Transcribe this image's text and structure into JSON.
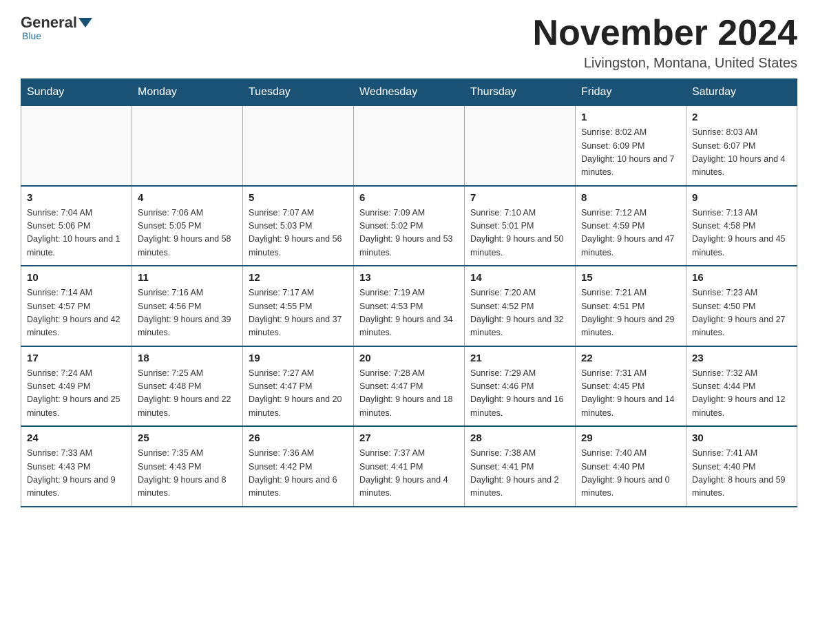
{
  "header": {
    "logo_general": "General",
    "logo_blue": "Blue",
    "month_title": "November 2024",
    "location": "Livingston, Montana, United States"
  },
  "weekdays": [
    "Sunday",
    "Monday",
    "Tuesday",
    "Wednesday",
    "Thursday",
    "Friday",
    "Saturday"
  ],
  "weeks": [
    [
      {
        "day": "",
        "sunrise": "",
        "sunset": "",
        "daylight": ""
      },
      {
        "day": "",
        "sunrise": "",
        "sunset": "",
        "daylight": ""
      },
      {
        "day": "",
        "sunrise": "",
        "sunset": "",
        "daylight": ""
      },
      {
        "day": "",
        "sunrise": "",
        "sunset": "",
        "daylight": ""
      },
      {
        "day": "",
        "sunrise": "",
        "sunset": "",
        "daylight": ""
      },
      {
        "day": "1",
        "sunrise": "Sunrise: 8:02 AM",
        "sunset": "Sunset: 6:09 PM",
        "daylight": "Daylight: 10 hours and 7 minutes."
      },
      {
        "day": "2",
        "sunrise": "Sunrise: 8:03 AM",
        "sunset": "Sunset: 6:07 PM",
        "daylight": "Daylight: 10 hours and 4 minutes."
      }
    ],
    [
      {
        "day": "3",
        "sunrise": "Sunrise: 7:04 AM",
        "sunset": "Sunset: 5:06 PM",
        "daylight": "Daylight: 10 hours and 1 minute."
      },
      {
        "day": "4",
        "sunrise": "Sunrise: 7:06 AM",
        "sunset": "Sunset: 5:05 PM",
        "daylight": "Daylight: 9 hours and 58 minutes."
      },
      {
        "day": "5",
        "sunrise": "Sunrise: 7:07 AM",
        "sunset": "Sunset: 5:03 PM",
        "daylight": "Daylight: 9 hours and 56 minutes."
      },
      {
        "day": "6",
        "sunrise": "Sunrise: 7:09 AM",
        "sunset": "Sunset: 5:02 PM",
        "daylight": "Daylight: 9 hours and 53 minutes."
      },
      {
        "day": "7",
        "sunrise": "Sunrise: 7:10 AM",
        "sunset": "Sunset: 5:01 PM",
        "daylight": "Daylight: 9 hours and 50 minutes."
      },
      {
        "day": "8",
        "sunrise": "Sunrise: 7:12 AM",
        "sunset": "Sunset: 4:59 PM",
        "daylight": "Daylight: 9 hours and 47 minutes."
      },
      {
        "day": "9",
        "sunrise": "Sunrise: 7:13 AM",
        "sunset": "Sunset: 4:58 PM",
        "daylight": "Daylight: 9 hours and 45 minutes."
      }
    ],
    [
      {
        "day": "10",
        "sunrise": "Sunrise: 7:14 AM",
        "sunset": "Sunset: 4:57 PM",
        "daylight": "Daylight: 9 hours and 42 minutes."
      },
      {
        "day": "11",
        "sunrise": "Sunrise: 7:16 AM",
        "sunset": "Sunset: 4:56 PM",
        "daylight": "Daylight: 9 hours and 39 minutes."
      },
      {
        "day": "12",
        "sunrise": "Sunrise: 7:17 AM",
        "sunset": "Sunset: 4:55 PM",
        "daylight": "Daylight: 9 hours and 37 minutes."
      },
      {
        "day": "13",
        "sunrise": "Sunrise: 7:19 AM",
        "sunset": "Sunset: 4:53 PM",
        "daylight": "Daylight: 9 hours and 34 minutes."
      },
      {
        "day": "14",
        "sunrise": "Sunrise: 7:20 AM",
        "sunset": "Sunset: 4:52 PM",
        "daylight": "Daylight: 9 hours and 32 minutes."
      },
      {
        "day": "15",
        "sunrise": "Sunrise: 7:21 AM",
        "sunset": "Sunset: 4:51 PM",
        "daylight": "Daylight: 9 hours and 29 minutes."
      },
      {
        "day": "16",
        "sunrise": "Sunrise: 7:23 AM",
        "sunset": "Sunset: 4:50 PM",
        "daylight": "Daylight: 9 hours and 27 minutes."
      }
    ],
    [
      {
        "day": "17",
        "sunrise": "Sunrise: 7:24 AM",
        "sunset": "Sunset: 4:49 PM",
        "daylight": "Daylight: 9 hours and 25 minutes."
      },
      {
        "day": "18",
        "sunrise": "Sunrise: 7:25 AM",
        "sunset": "Sunset: 4:48 PM",
        "daylight": "Daylight: 9 hours and 22 minutes."
      },
      {
        "day": "19",
        "sunrise": "Sunrise: 7:27 AM",
        "sunset": "Sunset: 4:47 PM",
        "daylight": "Daylight: 9 hours and 20 minutes."
      },
      {
        "day": "20",
        "sunrise": "Sunrise: 7:28 AM",
        "sunset": "Sunset: 4:47 PM",
        "daylight": "Daylight: 9 hours and 18 minutes."
      },
      {
        "day": "21",
        "sunrise": "Sunrise: 7:29 AM",
        "sunset": "Sunset: 4:46 PM",
        "daylight": "Daylight: 9 hours and 16 minutes."
      },
      {
        "day": "22",
        "sunrise": "Sunrise: 7:31 AM",
        "sunset": "Sunset: 4:45 PM",
        "daylight": "Daylight: 9 hours and 14 minutes."
      },
      {
        "day": "23",
        "sunrise": "Sunrise: 7:32 AM",
        "sunset": "Sunset: 4:44 PM",
        "daylight": "Daylight: 9 hours and 12 minutes."
      }
    ],
    [
      {
        "day": "24",
        "sunrise": "Sunrise: 7:33 AM",
        "sunset": "Sunset: 4:43 PM",
        "daylight": "Daylight: 9 hours and 9 minutes."
      },
      {
        "day": "25",
        "sunrise": "Sunrise: 7:35 AM",
        "sunset": "Sunset: 4:43 PM",
        "daylight": "Daylight: 9 hours and 8 minutes."
      },
      {
        "day": "26",
        "sunrise": "Sunrise: 7:36 AM",
        "sunset": "Sunset: 4:42 PM",
        "daylight": "Daylight: 9 hours and 6 minutes."
      },
      {
        "day": "27",
        "sunrise": "Sunrise: 7:37 AM",
        "sunset": "Sunset: 4:41 PM",
        "daylight": "Daylight: 9 hours and 4 minutes."
      },
      {
        "day": "28",
        "sunrise": "Sunrise: 7:38 AM",
        "sunset": "Sunset: 4:41 PM",
        "daylight": "Daylight: 9 hours and 2 minutes."
      },
      {
        "day": "29",
        "sunrise": "Sunrise: 7:40 AM",
        "sunset": "Sunset: 4:40 PM",
        "daylight": "Daylight: 9 hours and 0 minutes."
      },
      {
        "day": "30",
        "sunrise": "Sunrise: 7:41 AM",
        "sunset": "Sunset: 4:40 PM",
        "daylight": "Daylight: 8 hours and 59 minutes."
      }
    ]
  ]
}
